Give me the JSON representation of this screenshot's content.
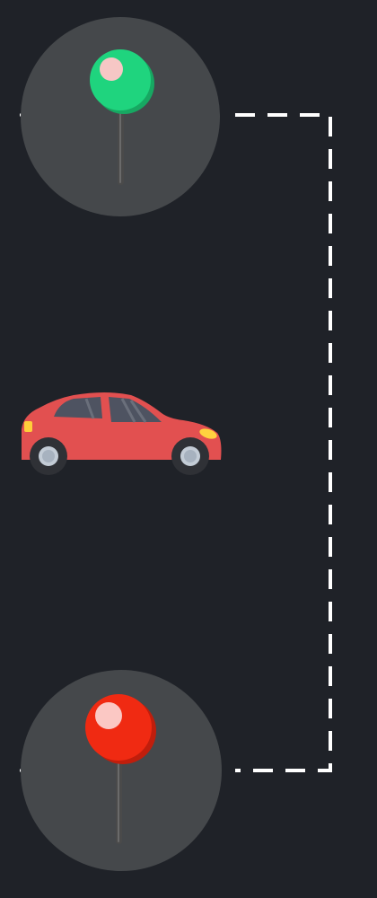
{
  "background_color": "#1f2228",
  "circle_color": "#45484b",
  "route_color": "#ffffff",
  "start_marker": {
    "icon": "green-map-pin-icon",
    "head_color": "#1fd47e",
    "head_shadow_color": "#17a862",
    "highlight_color": "#f6c7c5",
    "needle_color": "#4a4a4a"
  },
  "vehicle": {
    "icon": "red-car-icon",
    "body_color": "#e25050",
    "window_color": "#4e5361",
    "headlight_color": "#ffd23f",
    "taillight_color": "#ffce3a",
    "wheel_color": "#2f3136",
    "hub_color": "#c3ccd6"
  },
  "end_marker": {
    "icon": "red-map-pin-icon",
    "head_color": "#f02a12",
    "head_shadow_color": "#c01e0c",
    "highlight_color": "#fbc8c4",
    "needle_color": "#4a4a4a"
  }
}
